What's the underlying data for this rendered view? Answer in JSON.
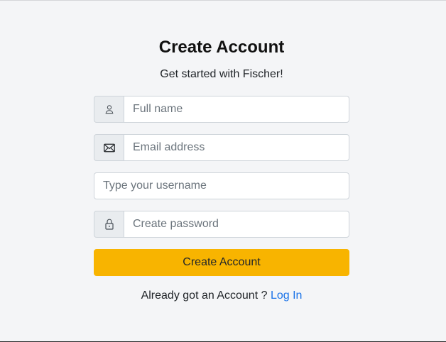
{
  "header": {
    "title": "Create Account",
    "subtitle": "Get started with Fischer!"
  },
  "form": {
    "full_name": {
      "placeholder": "Full name",
      "value": "",
      "icon": "user-icon"
    },
    "email": {
      "placeholder": "Email address",
      "value": "",
      "icon": "envelope-icon"
    },
    "username": {
      "placeholder": "Type your username",
      "value": ""
    },
    "password": {
      "placeholder": "Create password",
      "value": "",
      "icon": "lock-icon"
    },
    "submit_label": "Create Account"
  },
  "footer": {
    "prompt": "Already got an Account ?",
    "login_link": "Log In"
  },
  "colors": {
    "background": "#f4f5f7",
    "accent_button": "#f8b400",
    "link": "#1a73e8",
    "addon_bg": "#e9ecef",
    "border": "#ced4da"
  }
}
